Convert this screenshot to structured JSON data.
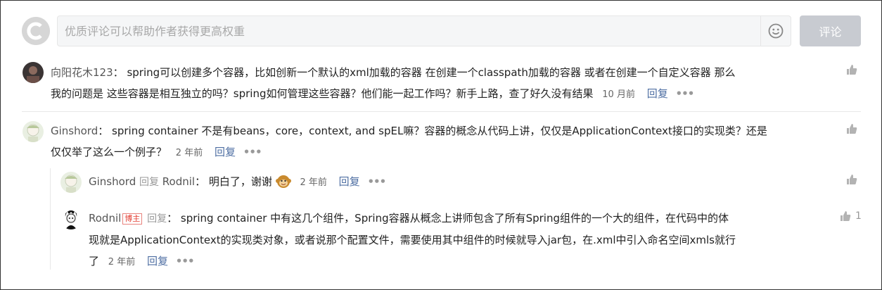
{
  "editor": {
    "placeholder": "优质评论可以帮助作者获得更高权重",
    "submit_label": "评论"
  },
  "comments": [
    {
      "author": "向阳花木123",
      "sep": "：",
      "text": "spring可以创建多个容器，比如创新一个默认的xml加载的容器 在创建一个classpath加载的容器 或者在创建一个自定义容器 那么",
      "text2": "我的问题是 这些容器是相互独立的吗？spring如何管理这些容器？他们能一起工作吗？新手上路，查了好久没有结果",
      "time": "10 月前",
      "reply_label": "回复",
      "more": "•••"
    },
    {
      "author": "Ginshord",
      "sep": "：",
      "text": "spring container 不是有beans，core，context, and spEL嘛？容器的概念从代码上讲，仅仅是ApplicationContext接口的实现类？还是",
      "text2": "仅仅举了这么一个例子？",
      "time": "2 年前",
      "reply_label": "回复",
      "more": "•••",
      "replies": [
        {
          "author": "Ginshord",
          "reply_word": "回复",
          "target": "Rodnil",
          "sep": "：",
          "text": "明白了，谢谢",
          "time": "2 年前",
          "reply_label": "回复",
          "more": "•••"
        },
        {
          "author": "Rodnil",
          "badge": "博主",
          "reply_word": "回复",
          "sep": "：",
          "text": "spring container 中有这几个组件，Spring容器从概念上讲师包含了所有Spring组件的一个大的组件，在代码中的体",
          "text2": "现就是ApplicationContext的实现类对象，或者说那个配置文件，需要使用其中组件的时候就导入jar包，在.xml中引入命名空间xmls就行",
          "text3": "了",
          "time": "2 年前",
          "reply_label": "回复",
          "more": "•••",
          "likes": "1"
        }
      ]
    }
  ],
  "colors": {
    "link": "#4f6fa3",
    "submit_bg": "#c8cbd1",
    "badge": "#e33e33"
  }
}
